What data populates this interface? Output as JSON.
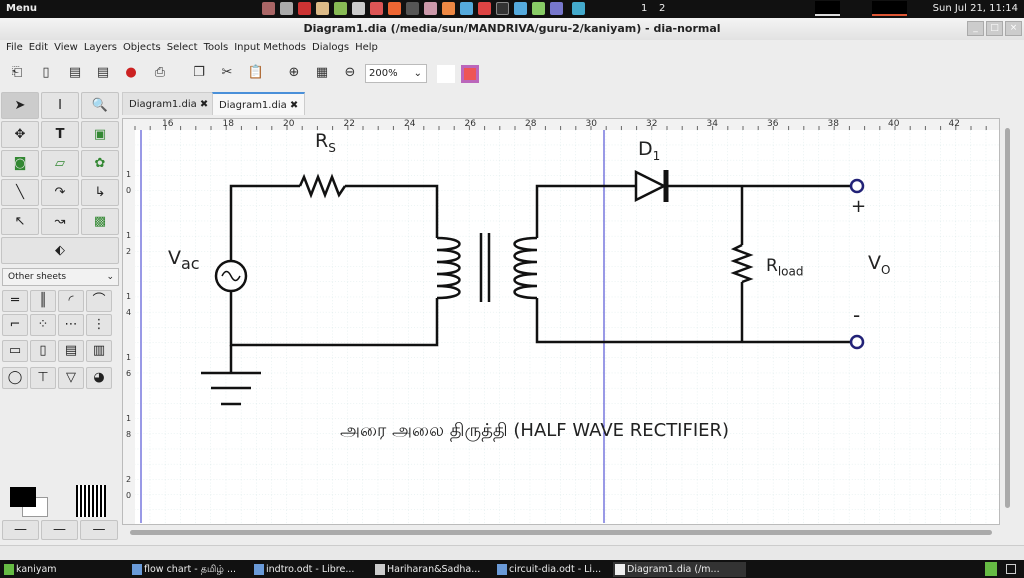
{
  "topbar": {
    "menu": "Menu",
    "clock": "Sun Jul 21, 11:14",
    "workspaces": [
      "1",
      "2"
    ]
  },
  "window": {
    "title": "Diagram1.dia (/media/sun/MANDRIVA/guru-2/kaniyam) - dia-normal"
  },
  "menu": [
    "File",
    "Edit",
    "View",
    "Layers",
    "Objects",
    "Select",
    "Tools",
    "Input Methods",
    "Dialogs",
    "Help"
  ],
  "toolbar": {
    "zoom": "200%"
  },
  "toolbox": {
    "sheet": "Other sheets"
  },
  "tabs": [
    {
      "label": "Diagram1.dia",
      "active": false
    },
    {
      "label": "Diagram1.dia",
      "active": true
    }
  ],
  "ruler": [
    "16",
    "18",
    "20",
    "22",
    "24",
    "26",
    "28",
    "30",
    "32",
    "34",
    "36",
    "38",
    "40",
    "42"
  ],
  "vruler": [
    "1",
    "0",
    "1",
    "2",
    "1",
    "4",
    "1",
    "6",
    "1",
    "8",
    "2",
    "0"
  ],
  "diagram": {
    "rs": "R",
    "rs_sub": "S",
    "d": "D",
    "d_sub": "1",
    "vac": "V",
    "vac_sub": "ac",
    "rload": "R",
    "rload_sub": "load",
    "vo": "V",
    "vo_sub": "O",
    "plus": "+",
    "minus": "-",
    "caption": "அரை அலை திருத்தி (HALF WAVE RECTIFIER)"
  },
  "taskbar": [
    "kaniyam",
    "flow chart - தமிழ் ...",
    "indtro.odt - Libre...",
    "Hariharan&Sadha...",
    "circuit-dia.odt - Li...",
    "Diagram1.dia (/m..."
  ]
}
